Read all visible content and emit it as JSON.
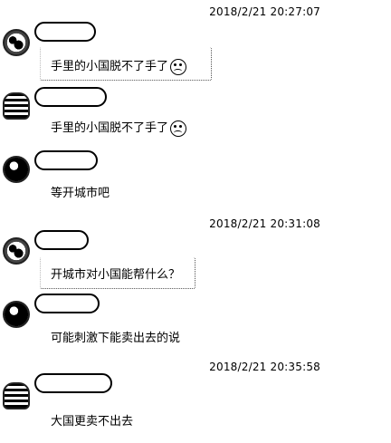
{
  "messages": [
    {
      "timestamp": "2018/2/21 20:27:07",
      "text": "手里的小国脱不了手了",
      "emoji": "sad-face-icon"
    },
    {
      "timestamp": "",
      "text": "手里的小国脱不了手了",
      "emoji": "sad-face-icon"
    },
    {
      "timestamp": "",
      "text": "等开城市吧"
    },
    {
      "timestamp": "2018/2/21 20:31:08",
      "text": "开城市对小国能帮什么？"
    },
    {
      "timestamp": "",
      "text": "可能刺激下能卖出去的说"
    },
    {
      "timestamp": "2018/2/21 20:35:58",
      "text": "大国更卖不出去"
    }
  ]
}
